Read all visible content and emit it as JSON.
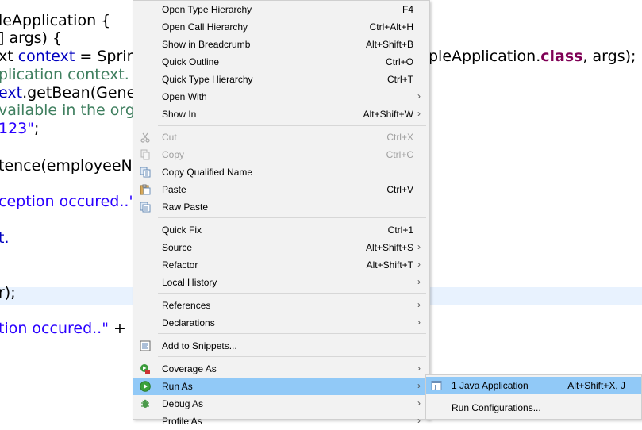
{
  "editor": {
    "lines": [
      [
        {
          "t": "leApplication {",
          "c": ""
        }
      ],
      [
        {
          "t": "] args) {",
          "c": ""
        }
      ],
      [
        {
          "t": "xt ",
          "c": ""
        },
        {
          "t": "context",
          "c": "c-field"
        },
        {
          "t": " = Sprin",
          "c": ""
        }
      ],
      [
        {
          "t": "plication context.",
          "c": "c-comment"
        }
      ],
      [
        {
          "t": "ext",
          "c": "c-field"
        },
        {
          "t": ".getBean(Gene",
          "c": ""
        }
      ],
      [
        {
          "t": "vailable in the org",
          "c": "c-comment"
        }
      ],
      [
        {
          "t": "123\"",
          "c": "c-str"
        },
        {
          "t": ";",
          "c": ""
        }
      ],
      [
        {
          "t": "tence(employeeNu",
          "c": ""
        }
      ],
      [
        {
          "t": "ception occured..\"",
          "c": "c-str"
        }
      ],
      [
        {
          "t": "t.",
          "c": "c-field"
        }
      ],
      [
        {
          "t": "r);",
          "c": ""
        }
      ],
      [
        {
          "t": "tion occured..\"",
          "c": "c-str"
        },
        {
          "t": " +",
          "c": ""
        }
      ]
    ],
    "right_fragment": [
      {
        "t": "pleApplication.",
        "c": ""
      },
      {
        "t": "class",
        "c": "c-kw"
      },
      {
        "t": ", args);",
        "c": ""
      }
    ]
  },
  "menu": {
    "items": [
      {
        "label": "Open Type Hierarchy",
        "shortcut": "F4",
        "arrow": false,
        "disabled": false
      },
      {
        "label": "Open Call Hierarchy",
        "shortcut": "Ctrl+Alt+H",
        "arrow": false,
        "disabled": false
      },
      {
        "label": "Show in Breadcrumb",
        "shortcut": "Alt+Shift+B",
        "arrow": false,
        "disabled": false
      },
      {
        "label": "Quick Outline",
        "shortcut": "Ctrl+O",
        "arrow": false,
        "disabled": false
      },
      {
        "label": "Quick Type Hierarchy",
        "shortcut": "Ctrl+T",
        "arrow": false,
        "disabled": false
      },
      {
        "label": "Open With",
        "shortcut": "",
        "arrow": true,
        "disabled": false
      },
      {
        "label": "Show In",
        "shortcut": "Alt+Shift+W",
        "arrow": true,
        "disabled": false
      },
      {
        "label": "Cut",
        "shortcut": "Ctrl+X",
        "arrow": false,
        "disabled": true,
        "icon": "cut-icon"
      },
      {
        "label": "Copy",
        "shortcut": "Ctrl+C",
        "arrow": false,
        "disabled": true,
        "icon": "copy-icon"
      },
      {
        "label": "Copy Qualified Name",
        "shortcut": "",
        "arrow": false,
        "disabled": false,
        "icon": "copy-qualified-icon"
      },
      {
        "label": "Paste",
        "shortcut": "Ctrl+V",
        "arrow": false,
        "disabled": false,
        "icon": "paste-icon"
      },
      {
        "label": "Raw Paste",
        "shortcut": "",
        "arrow": false,
        "disabled": false,
        "icon": "raw-paste-icon"
      },
      {
        "label": "Quick Fix",
        "shortcut": "Ctrl+1",
        "arrow": false,
        "disabled": false
      },
      {
        "label": "Source",
        "shortcut": "Alt+Shift+S",
        "arrow": true,
        "disabled": false
      },
      {
        "label": "Refactor",
        "shortcut": "Alt+Shift+T",
        "arrow": true,
        "disabled": false
      },
      {
        "label": "Local History",
        "shortcut": "",
        "arrow": true,
        "disabled": false
      },
      {
        "label": "References",
        "shortcut": "",
        "arrow": true,
        "disabled": false
      },
      {
        "label": "Declarations",
        "shortcut": "",
        "arrow": true,
        "disabled": false
      },
      {
        "label": "Add to Snippets...",
        "shortcut": "",
        "arrow": false,
        "disabled": false,
        "icon": "snippets-icon"
      },
      {
        "label": "Coverage As",
        "shortcut": "",
        "arrow": true,
        "disabled": false,
        "icon": "coverage-icon"
      },
      {
        "label": "Run As",
        "shortcut": "",
        "arrow": true,
        "disabled": false,
        "icon": "run-icon",
        "selected": true
      },
      {
        "label": "Debug As",
        "shortcut": "",
        "arrow": true,
        "disabled": false,
        "icon": "debug-icon"
      },
      {
        "label": "Profile As",
        "shortcut": "",
        "arrow": true,
        "disabled": false
      }
    ]
  },
  "submenu": {
    "items": [
      {
        "label": "1 Java Application",
        "shortcut": "Alt+Shift+X, J",
        "icon": "java-app-icon",
        "selected": true
      },
      {
        "label": "Run Configurations...",
        "shortcut": "",
        "selected": false
      }
    ]
  },
  "colors": {
    "menu_bg": "#f2f2f2",
    "selection": "#91c9f7",
    "line_highlight": "#e8f2fe",
    "keyword": "#7f0055",
    "string": "#2a00ff",
    "comment": "#3f7f5f",
    "field": "#0000c0"
  }
}
